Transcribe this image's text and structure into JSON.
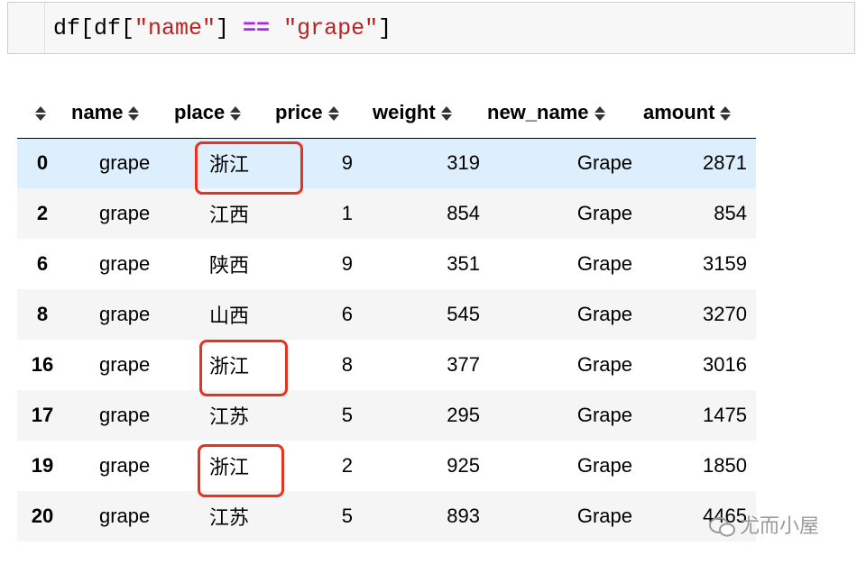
{
  "code": {
    "tokens": [
      "df[df[",
      "\"name\"",
      "] ",
      "==",
      " ",
      "\"grape\"",
      "]"
    ]
  },
  "table": {
    "columns": [
      "name",
      "place",
      "price",
      "weight",
      "new_name",
      "amount"
    ],
    "rows": [
      {
        "index": "0",
        "name": "grape",
        "place": "浙江",
        "price": "9",
        "weight": "319",
        "new_name": "Grape",
        "amount": "2871"
      },
      {
        "index": "2",
        "name": "grape",
        "place": "江西",
        "price": "1",
        "weight": "854",
        "new_name": "Grape",
        "amount": "854"
      },
      {
        "index": "6",
        "name": "grape",
        "place": "陕西",
        "price": "9",
        "weight": "351",
        "new_name": "Grape",
        "amount": "3159"
      },
      {
        "index": "8",
        "name": "grape",
        "place": "山西",
        "price": "6",
        "weight": "545",
        "new_name": "Grape",
        "amount": "3270"
      },
      {
        "index": "16",
        "name": "grape",
        "place": "浙江",
        "price": "8",
        "weight": "377",
        "new_name": "Grape",
        "amount": "3016"
      },
      {
        "index": "17",
        "name": "grape",
        "place": "江苏",
        "price": "5",
        "weight": "295",
        "new_name": "Grape",
        "amount": "1475"
      },
      {
        "index": "19",
        "name": "grape",
        "place": "浙江",
        "price": "2",
        "weight": "925",
        "new_name": "Grape",
        "amount": "1850"
      },
      {
        "index": "20",
        "name": "grape",
        "place": "江苏",
        "price": "5",
        "weight": "893",
        "new_name": "Grape",
        "amount": "4465"
      }
    ]
  },
  "watermark": {
    "text": "尤而小屋"
  },
  "colors": {
    "highlight_box": "#e8321e",
    "selected_row": "#ddeefc"
  }
}
